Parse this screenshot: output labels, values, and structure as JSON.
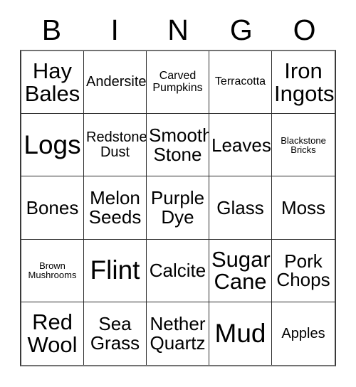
{
  "card": {
    "title": "BINGO",
    "header_letters": [
      "B",
      "I",
      "N",
      "G",
      "O"
    ],
    "background_color": "#ffffff",
    "text_color": "#000000",
    "border_color": "#2b2b2b",
    "grid": {
      "columns": 5,
      "rows": 5,
      "free_space": false
    }
  },
  "cells": [
    {
      "text": "Hay\nBales",
      "size": "fs-lg",
      "column": "B",
      "row": 1
    },
    {
      "text": "Andersite",
      "size": "fs-sm",
      "column": "I",
      "row": 1
    },
    {
      "text": "Carved\nPumpkins",
      "size": "fs-xs",
      "column": "N",
      "row": 1
    },
    {
      "text": "Terracotta",
      "size": "fs-xs",
      "column": "G",
      "row": 1
    },
    {
      "text": "Iron\nIngots",
      "size": "fs-lg",
      "column": "O",
      "row": 1
    },
    {
      "text": "Logs",
      "size": "fs-xl",
      "column": "B",
      "row": 2
    },
    {
      "text": "Redstone\nDust",
      "size": "fs-sm",
      "column": "I",
      "row": 2
    },
    {
      "text": "Smooth\nStone",
      "size": "fs-md",
      "column": "N",
      "row": 2
    },
    {
      "text": "Leaves",
      "size": "fs-md",
      "column": "G",
      "row": 2
    },
    {
      "text": "Blackstone\nBricks",
      "size": "fs-xxs",
      "column": "O",
      "row": 2
    },
    {
      "text": "Bones",
      "size": "fs-md",
      "column": "B",
      "row": 3
    },
    {
      "text": "Melon\nSeeds",
      "size": "fs-md",
      "column": "I",
      "row": 3
    },
    {
      "text": "Purple\nDye",
      "size": "fs-md",
      "column": "N",
      "row": 3
    },
    {
      "text": "Glass",
      "size": "fs-md",
      "column": "G",
      "row": 3
    },
    {
      "text": "Moss",
      "size": "fs-md",
      "column": "O",
      "row": 3
    },
    {
      "text": "Brown\nMushrooms",
      "size": "fs-xxs",
      "column": "B",
      "row": 4
    },
    {
      "text": "Flint",
      "size": "fs-xl",
      "column": "I",
      "row": 4
    },
    {
      "text": "Calcite",
      "size": "fs-md",
      "column": "N",
      "row": 4
    },
    {
      "text": "Sugar\nCane",
      "size": "fs-lg",
      "column": "G",
      "row": 4
    },
    {
      "text": "Pork\nChops",
      "size": "fs-md",
      "column": "O",
      "row": 4
    },
    {
      "text": "Red\nWool",
      "size": "fs-lg",
      "column": "B",
      "row": 5
    },
    {
      "text": "Sea\nGrass",
      "size": "fs-md",
      "column": "I",
      "row": 5
    },
    {
      "text": "Nether\nQuartz",
      "size": "fs-md",
      "column": "N",
      "row": 5
    },
    {
      "text": "Mud",
      "size": "fs-xl",
      "column": "G",
      "row": 5
    },
    {
      "text": "Apples",
      "size": "fs-sm",
      "column": "O",
      "row": 5
    }
  ]
}
